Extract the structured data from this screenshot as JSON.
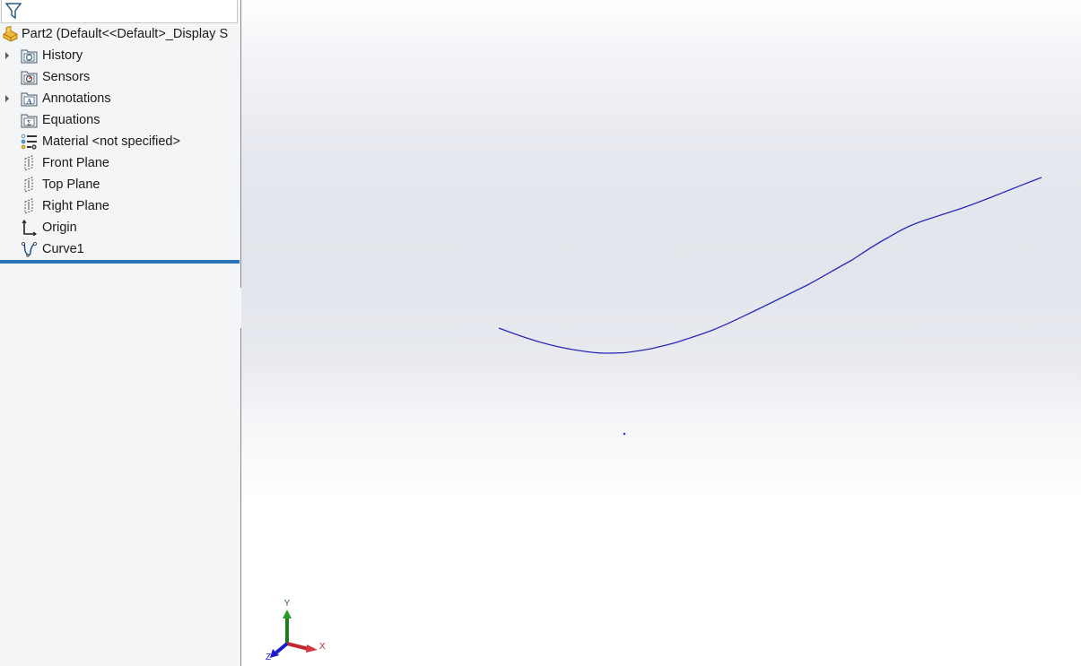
{
  "feature_tree": {
    "filter_icon": "filter-icon",
    "root": {
      "label": "Part2  (Default<<Default>_Display S",
      "icon": "part-icon"
    },
    "items": [
      {
        "label": "History",
        "icon": "history-folder-icon",
        "expandable": true
      },
      {
        "label": "Sensors",
        "icon": "sensors-folder-icon",
        "expandable": false
      },
      {
        "label": "Annotations",
        "icon": "annotations-folder-icon",
        "expandable": true
      },
      {
        "label": "Equations",
        "icon": "equations-folder-icon",
        "expandable": false
      },
      {
        "label": "Material <not specified>",
        "icon": "material-icon",
        "expandable": false
      },
      {
        "label": "Front Plane",
        "icon": "plane-icon",
        "expandable": false
      },
      {
        "label": "Top Plane",
        "icon": "plane-icon",
        "expandable": false
      },
      {
        "label": "Right Plane",
        "icon": "plane-icon",
        "expandable": false
      },
      {
        "label": "Origin",
        "icon": "origin-icon",
        "expandable": false
      },
      {
        "label": "Curve1",
        "icon": "curve-icon",
        "expandable": false
      }
    ]
  },
  "viewport": {
    "curve_name": "Curve1",
    "curve_color": "#2a2ab8",
    "triad": {
      "x_label": "X",
      "y_label": "Y",
      "z_label": "Z",
      "x_color": "#c0282d",
      "y_color": "#1f7a1f",
      "z_color": "#1a1acc"
    }
  },
  "colors": {
    "selection_bar": "#2a74b8",
    "panel_bg": "#f4f5f7"
  }
}
